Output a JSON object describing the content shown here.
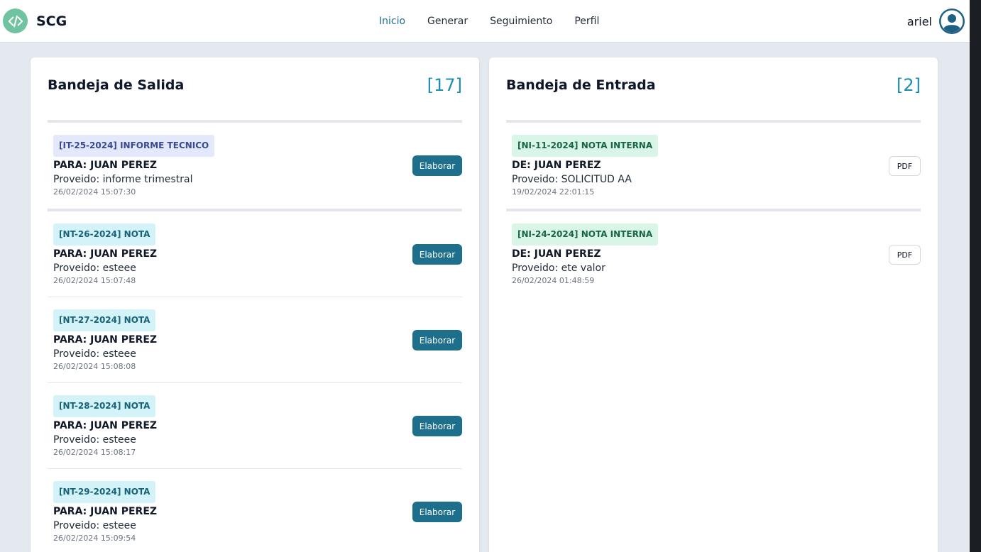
{
  "navbar": {
    "brand": "SCG",
    "links": [
      {
        "label": "Inicio",
        "active": true
      },
      {
        "label": "Generar",
        "active": false
      },
      {
        "label": "Seguimiento",
        "active": false
      },
      {
        "label": "Perfil",
        "active": false
      }
    ],
    "user": "ariel"
  },
  "outbox": {
    "title": "Bandeja de Salida",
    "count": "[17]",
    "items": [
      {
        "tag": "[IT-25-2024] INFORME TECNICO",
        "kind": "it",
        "to": "PARA: JUAN PEREZ",
        "proveido": "Proveido: informe trimestral",
        "date": "26/02/2024 15:07:30",
        "action": "Elaborar"
      },
      {
        "tag": "[NT-26-2024] NOTA",
        "kind": "nt",
        "to": "PARA: JUAN PEREZ",
        "proveido": "Proveido: esteee",
        "date": "26/02/2024 15:07:48",
        "action": "Elaborar"
      },
      {
        "tag": "[NT-27-2024] NOTA",
        "kind": "nt",
        "to": "PARA: JUAN PEREZ",
        "proveido": "Proveido: esteee",
        "date": "26/02/2024 15:08:08",
        "action": "Elaborar"
      },
      {
        "tag": "[NT-28-2024] NOTA",
        "kind": "nt",
        "to": "PARA: JUAN PEREZ",
        "proveido": "Proveido: esteee",
        "date": "26/02/2024 15:08:17",
        "action": "Elaborar"
      },
      {
        "tag": "[NT-29-2024] NOTA",
        "kind": "nt",
        "to": "PARA: JUAN PEREZ",
        "proveido": "Proveido: esteee",
        "date": "26/02/2024 15:09:54",
        "action": "Elaborar"
      }
    ]
  },
  "inbox": {
    "title": "Bandeja de Entrada",
    "count": "[2]",
    "items": [
      {
        "tag": "[NI-11-2024] NOTA INTERNA",
        "kind": "ni",
        "from": "DE: JUAN PEREZ",
        "proveido": "Proveido: SOLICITUD AA",
        "date": "19/02/2024 22:01:15",
        "action": "PDF"
      },
      {
        "tag": "[NI-24-2024] NOTA INTERNA",
        "kind": "ni",
        "from": "DE: JUAN PEREZ",
        "proveido": "Proveido: ete valor",
        "date": "26/02/2024 01:48:59",
        "action": "PDF"
      }
    ]
  },
  "colors": {
    "accent": "#1e6f8c",
    "count": "#1c8fb0",
    "background": "#e4e8ef"
  },
  "icons": {
    "brand": "code-icon",
    "avatar": "user-circle-icon"
  }
}
